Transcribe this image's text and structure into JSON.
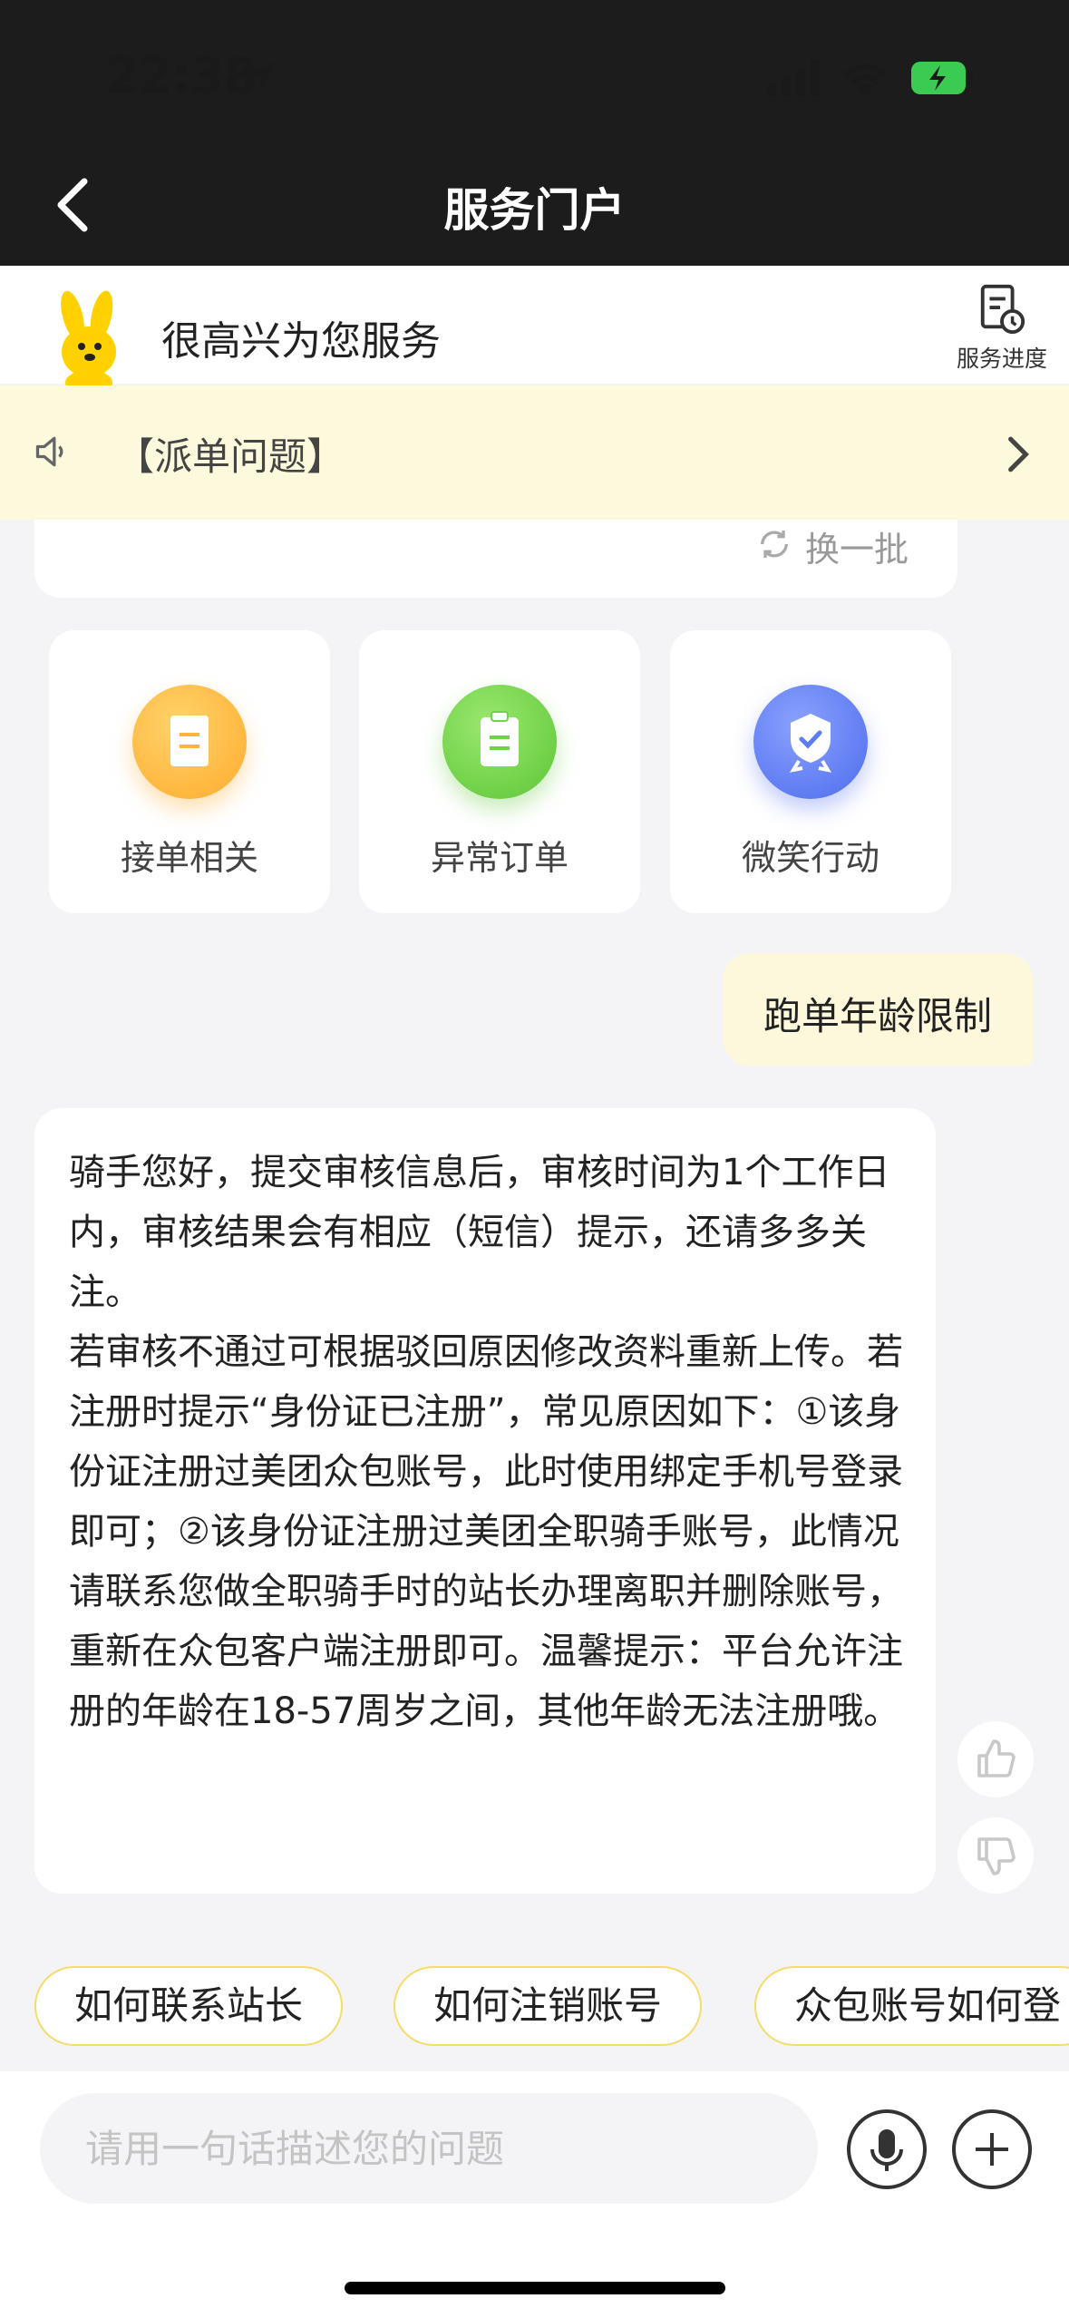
{
  "status_bar": {
    "time": "22:38"
  },
  "nav": {
    "title": "服务门户"
  },
  "welcome": {
    "text": "很高兴为您服务",
    "progress_label": "服务进度"
  },
  "notice": {
    "text": "【派单问题】"
  },
  "refresh": {
    "label": "换一批"
  },
  "categories": [
    {
      "label": "接单相关",
      "color": "#ffb53d",
      "icon": "receipt-icon"
    },
    {
      "label": "异常订单",
      "color": "#6fd24a",
      "icon": "clipboard-icon"
    },
    {
      "label": "微笑行动",
      "color": "#5b7cf2",
      "icon": "badge-icon"
    }
  ],
  "user_message": "跑单年龄限制",
  "bot_message": {
    "paragraph1": "骑手您好，提交审核信息后，审核时间为1个工作日内，审核结果会有相应（短信）提示，还请多多关注。",
    "paragraph2": "若审核不通过可根据驳回原因修改资料重新上传。若注册时提示“身份证已注册”，常见原因如下：①该身份证注册过美团众包账号，此时使用绑定手机号登录即可；②该身份证注册过美团全职骑手账号，此情况请联系您做全职骑手时的站长办理离职并删除账号，重新在众包客户端注册即可。温馨提示：平台允许注册的年龄在18-57周岁之间，其他年龄无法注册哦。"
  },
  "suggestions": [
    "如何联系站长",
    "如何注销账号",
    "众包账号如何登"
  ],
  "input": {
    "placeholder": "请用一句话描述您的问题",
    "value": ""
  },
  "colors": {
    "accent": "#ffd100",
    "notice_bg": "#fdf9dc",
    "chip_border": "#f4dc69"
  }
}
